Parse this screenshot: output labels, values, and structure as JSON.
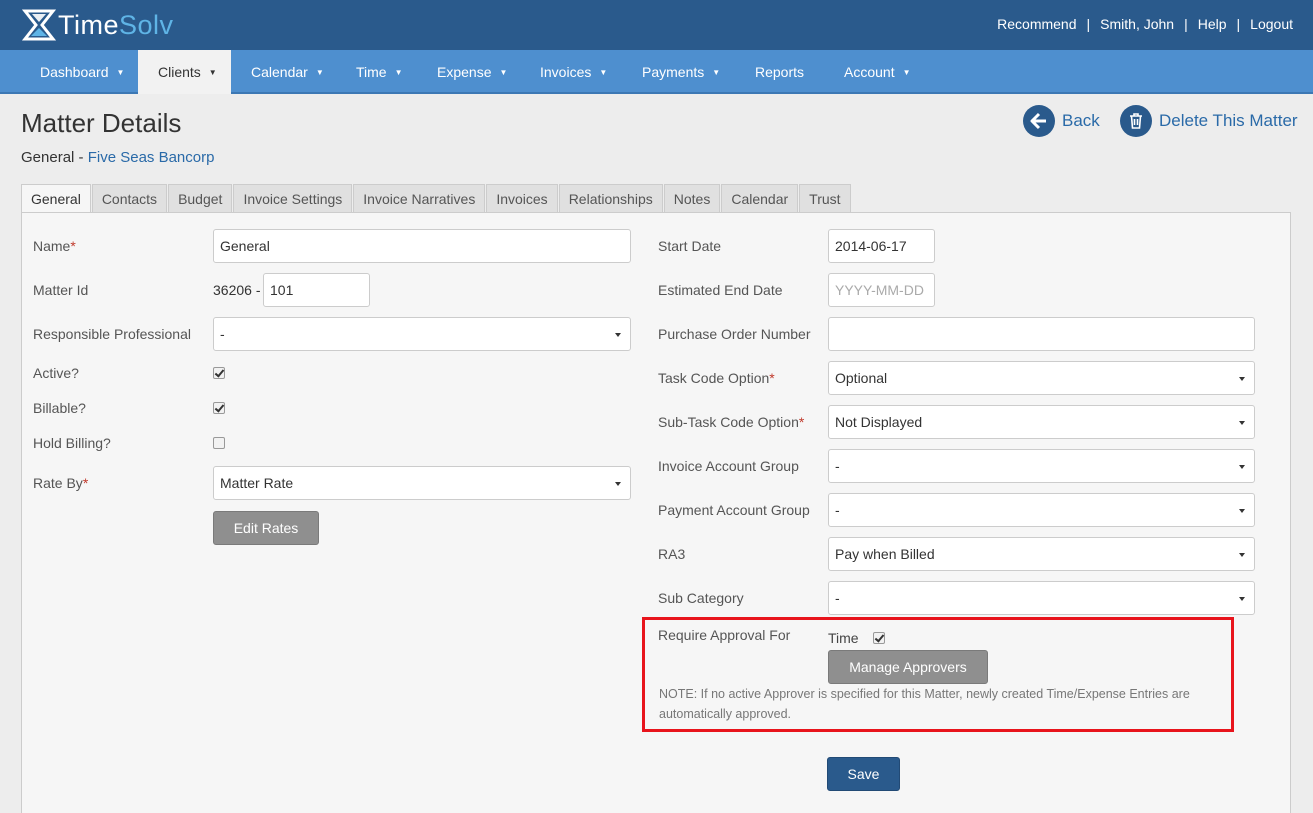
{
  "brand": {
    "time": "Time",
    "solv": "Solv"
  },
  "header_links": {
    "recommend": "Recommend",
    "user": "Smith, John",
    "help": "Help",
    "logout": "Logout",
    "separator": "|"
  },
  "nav": {
    "dashboard": "Dashboard",
    "clients": "Clients",
    "calendar": "Calendar",
    "time": "Time",
    "expense": "Expense",
    "invoices": "Invoices",
    "payments": "Payments",
    "reports": "Reports",
    "account": "Account"
  },
  "page": {
    "title": "Matter Details",
    "matter_name": "General",
    "subtitle_sep": " - ",
    "client_name": "Five Seas Bancorp",
    "back": "Back",
    "delete": "Delete This Matter"
  },
  "tabs": {
    "general": "General",
    "contacts": "Contacts",
    "budget": "Budget",
    "invoice_settings": "Invoice Settings",
    "invoice_narratives": "Invoice Narratives",
    "invoices": "Invoices",
    "relationships": "Relationships",
    "notes": "Notes",
    "calendar": "Calendar",
    "trust": "Trust"
  },
  "left": {
    "name_label": "Name",
    "name_value": "General",
    "matter_id_label": "Matter Id",
    "matter_id_prefix": "36206 -",
    "matter_id_value": "101",
    "responsible_label": "Responsible Professional",
    "responsible_value": "-",
    "active_label": "Active?",
    "active_checked": true,
    "billable_label": "Billable?",
    "billable_checked": true,
    "hold_label": "Hold Billing?",
    "hold_checked": false,
    "rate_by_label": "Rate By",
    "rate_by_value": "Matter Rate",
    "edit_rates": "Edit Rates"
  },
  "right": {
    "start_label": "Start Date",
    "start_value": "2014-06-17",
    "end_label": "Estimated End Date",
    "end_placeholder": "YYYY-MM-DD",
    "po_label": "Purchase Order Number",
    "po_value": "",
    "task_label": "Task Code Option",
    "task_value": "Optional",
    "subtask_label": "Sub-Task Code Option",
    "subtask_value": "Not Displayed",
    "inv_group_label": "Invoice Account Group",
    "inv_group_value": "-",
    "pay_group_label": "Payment Account Group",
    "pay_group_value": "-",
    "ra3_label": "RA3",
    "ra3_value": "Pay when Billed",
    "subcat_label": "Sub Category",
    "subcat_value": "-",
    "approval_label": "Require Approval For",
    "approval_time_label": "Time",
    "approval_time_checked": true,
    "manage_approvers": "Manage Approvers",
    "note": "NOTE: If no active Approver is specified for this Matter, newly created Time/Expense Entries are automatically approved."
  },
  "save": "Save",
  "colors": {
    "header": "#2a5a8c",
    "nav": "#4e8fcf",
    "highlight_box": "#e8141c",
    "primary_button": "#2a5a8c"
  },
  "required_marker": "*"
}
